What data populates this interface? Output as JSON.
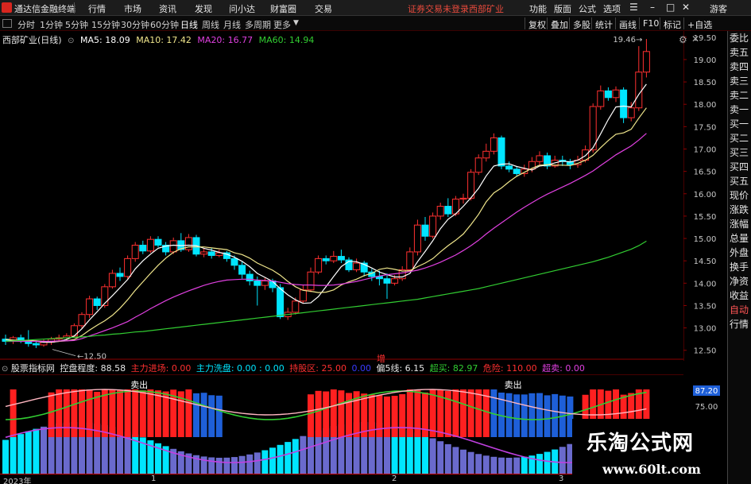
{
  "menu": {
    "app_title": "通达信金融终端",
    "items": [
      "行情",
      "市场",
      "资讯",
      "发现",
      "问小达",
      "财富圈",
      "交易"
    ],
    "notice": "证券交易未登录",
    "stock_name": "西部矿业",
    "right_items": [
      "功能",
      "版面",
      "公式",
      "选项"
    ],
    "guest": "游客"
  },
  "periods": {
    "items": [
      "分时",
      "1分钟",
      "5分钟",
      "15分钟",
      "30分钟",
      "60分钟",
      "日线",
      "周线",
      "月线",
      "多周期",
      "更多"
    ],
    "active": "日线"
  },
  "tools": [
    "复权",
    "叠加",
    "多股",
    "统计",
    "画线",
    "F10",
    "标记",
    "+自选"
  ],
  "legend": {
    "title": "西部矿业(日线)",
    "ma5": "MA5: 18.09",
    "ma10": "MA10: 17.42",
    "ma20": "MA20: 16.77",
    "ma60": "MA60: 14.94"
  },
  "sidebar": [
    "委比",
    "卖五",
    "卖四",
    "卖三",
    "卖二",
    "卖一",
    "买一",
    "买二",
    "买三",
    "买四",
    "买五",
    "现价",
    "涨跌",
    "涨幅",
    "总量",
    "外盘",
    "换手",
    "净资",
    "收益",
    "自动",
    "行情"
  ],
  "indicator": {
    "name": "股票指标网",
    "kpcd_label": "控盘程度:",
    "kpcd": "88.58",
    "zljc_label": "主力进场:",
    "zljc": "0.00",
    "zlxp_label": "主力洗盘:",
    "zlxp": "0.00 : 0.00",
    "ccq_label": "持股区:",
    "ccq": "25.00",
    "jxx_label": "偏5线:",
    "jxx": "6.15",
    "cm_label": "超买:",
    "cm": "82.97",
    "wx_label": "危险:",
    "wx": "110.00",
    "cmai_label": "超卖:",
    "cmai": "0.00",
    "sell_label": "卖出",
    "axis_labels": [
      "87.20",
      "75.00"
    ]
  },
  "increase_mark": "增",
  "dates": [
    "2023年",
    "1",
    "2",
    "3"
  ],
  "watermark": {
    "title": "乐淘公式网",
    "url": "www.60lt.com"
  },
  "colors": {
    "up": "#ff3030",
    "down": "#00e5ff",
    "ma5": "#ffffff",
    "ma10": "#f0e68c",
    "ma20": "#e040e0",
    "ma60": "#32cd32"
  },
  "chart_data": {
    "type": "candlestick",
    "ylim": [
      12.3,
      19.55
    ],
    "y_ticks": [
      "19.50",
      "19.00",
      "18.50",
      "18.00",
      "17.50",
      "17.00",
      "16.50",
      "16.00",
      "15.50",
      "15.00",
      "14.50",
      "14.00",
      "13.50",
      "13.00",
      "12.50"
    ],
    "low_label": "12.50",
    "high_label": "19.46",
    "candles": [
      [
        12.75,
        12.7,
        12.85,
        12.62
      ],
      [
        12.7,
        12.78,
        12.82,
        12.64
      ],
      [
        12.78,
        12.72,
        12.85,
        12.66
      ],
      [
        12.72,
        12.65,
        12.95,
        12.58
      ],
      [
        12.65,
        12.62,
        12.72,
        12.55
      ],
      [
        12.62,
        12.68,
        12.74,
        12.58
      ],
      [
        12.68,
        12.75,
        12.8,
        12.62
      ],
      [
        12.75,
        12.78,
        12.85,
        12.7
      ],
      [
        12.78,
        12.82,
        12.88,
        12.72
      ],
      [
        12.82,
        13.05,
        13.1,
        12.78
      ],
      [
        13.05,
        13.3,
        13.35,
        12.98
      ],
      [
        13.3,
        13.65,
        13.72,
        13.22
      ],
      [
        13.65,
        13.5,
        13.7,
        13.4
      ],
      [
        13.5,
        13.92,
        13.98,
        13.45
      ],
      [
        13.92,
        14.22,
        14.3,
        13.88
      ],
      [
        14.22,
        14.15,
        14.35,
        14.05
      ],
      [
        14.15,
        14.55,
        14.62,
        14.1
      ],
      [
        14.55,
        14.85,
        14.92,
        14.48
      ],
      [
        14.85,
        14.72,
        14.95,
        14.65
      ],
      [
        14.72,
        14.98,
        15.05,
        14.68
      ],
      [
        14.98,
        14.85,
        15.05,
        14.8
      ],
      [
        14.85,
        14.7,
        14.92,
        14.62
      ],
      [
        14.7,
        14.95,
        15.02,
        14.65
      ],
      [
        14.95,
        14.75,
        15.12,
        14.7
      ],
      [
        14.75,
        15.02,
        15.1,
        14.7
      ],
      [
        15.02,
        14.65,
        15.08,
        14.6
      ],
      [
        14.65,
        14.7,
        14.78,
        14.58
      ],
      [
        14.7,
        14.62,
        14.78,
        14.55
      ],
      [
        14.62,
        14.68,
        14.75,
        14.58
      ],
      [
        14.68,
        14.55,
        14.72,
        14.48
      ],
      [
        14.55,
        14.4,
        14.62,
        14.3
      ],
      [
        14.4,
        14.2,
        14.48,
        14.1
      ],
      [
        14.2,
        14.05,
        14.28,
        13.95
      ],
      [
        14.05,
        13.95,
        14.15,
        13.5
      ],
      [
        13.95,
        14.05,
        14.12,
        13.85
      ],
      [
        14.05,
        13.9,
        14.1,
        13.8
      ],
      [
        13.9,
        13.25,
        13.98,
        13.2
      ],
      [
        13.25,
        13.35,
        13.45,
        13.18
      ],
      [
        13.35,
        13.6,
        13.68,
        13.3
      ],
      [
        13.6,
        13.85,
        13.95,
        13.55
      ],
      [
        13.85,
        14.25,
        14.35,
        13.8
      ],
      [
        14.25,
        14.55,
        14.62,
        14.2
      ],
      [
        14.55,
        14.5,
        14.62,
        14.42
      ],
      [
        14.5,
        14.6,
        14.72,
        14.45
      ],
      [
        14.6,
        14.52,
        14.75,
        14.45
      ],
      [
        14.52,
        14.3,
        14.58,
        14.25
      ],
      [
        14.3,
        14.45,
        14.55,
        14.25
      ],
      [
        14.45,
        14.25,
        14.5,
        14.15
      ],
      [
        14.25,
        14.15,
        14.32,
        14.05
      ],
      [
        14.15,
        14.1,
        14.28,
        13.95
      ],
      [
        14.1,
        14.0,
        14.22,
        13.65
      ],
      [
        14.0,
        14.1,
        14.18,
        13.95
      ],
      [
        14.1,
        14.3,
        14.38,
        14.05
      ],
      [
        14.3,
        14.7,
        14.8,
        14.25
      ],
      [
        14.7,
        15.3,
        15.42,
        14.62
      ],
      [
        15.3,
        15.05,
        15.48,
        14.95
      ],
      [
        15.05,
        15.5,
        15.58,
        15.0
      ],
      [
        15.5,
        15.72,
        15.8,
        15.42
      ],
      [
        15.72,
        15.55,
        15.9,
        15.48
      ],
      [
        15.55,
        15.88,
        15.95,
        15.5
      ],
      [
        15.88,
        15.9,
        16.0,
        15.78
      ],
      [
        15.9,
        16.48,
        16.55,
        15.85
      ],
      [
        16.48,
        16.8,
        16.88,
        16.42
      ],
      [
        16.8,
        16.95,
        17.12,
        16.72
      ],
      [
        16.95,
        17.25,
        17.35,
        16.88
      ],
      [
        17.25,
        16.62,
        17.3,
        16.55
      ],
      [
        16.62,
        16.55,
        16.72,
        16.48
      ],
      [
        16.55,
        16.45,
        16.62,
        16.38
      ],
      [
        16.45,
        16.55,
        16.65,
        16.38
      ],
      [
        16.55,
        16.72,
        16.82,
        16.48
      ],
      [
        16.72,
        16.85,
        16.95,
        16.65
      ],
      [
        16.85,
        16.62,
        16.92,
        16.55
      ],
      [
        16.62,
        16.75,
        16.85,
        16.58
      ],
      [
        16.75,
        16.72,
        16.85,
        16.62
      ],
      [
        16.72,
        16.65,
        16.78,
        16.55
      ],
      [
        16.65,
        16.75,
        16.85,
        16.58
      ],
      [
        16.75,
        16.98,
        17.08,
        16.7
      ],
      [
        16.98,
        17.95,
        18.02,
        16.92
      ],
      [
        17.95,
        18.3,
        18.42,
        17.88
      ],
      [
        18.3,
        18.15,
        18.38,
        18.08
      ],
      [
        18.15,
        18.32,
        18.4,
        18.05
      ],
      [
        18.32,
        17.7,
        18.38,
        17.58
      ],
      [
        17.7,
        17.92,
        18.05,
        17.62
      ],
      [
        17.92,
        18.72,
        19.3,
        17.85
      ],
      [
        18.72,
        19.18,
        19.46,
        18.6
      ]
    ],
    "ma_series": [
      {
        "name": "MA5",
        "values": [
          12.74,
          12.72,
          12.72,
          12.71,
          12.7,
          12.68,
          12.68,
          12.7,
          12.74,
          12.82,
          12.98,
          13.18,
          13.36,
          13.55,
          13.72,
          13.9,
          14.08,
          14.32,
          14.5,
          14.65,
          14.78,
          14.83,
          14.85,
          14.84,
          14.85,
          14.84,
          14.78,
          14.74,
          14.69,
          14.65,
          14.58,
          14.49,
          14.37,
          14.22,
          14.13,
          14.04,
          13.88,
          13.74,
          13.63,
          13.55,
          13.56,
          13.7,
          13.92,
          14.15,
          14.37,
          14.49,
          14.48,
          14.42,
          14.34,
          14.25,
          14.19,
          14.14,
          14.14,
          14.22,
          14.48,
          14.71,
          14.95,
          15.22,
          15.43,
          15.55,
          15.72,
          15.91,
          16.12,
          16.4,
          16.62,
          16.66,
          16.67,
          16.61,
          16.57,
          16.53,
          16.62,
          16.64,
          16.69,
          16.73,
          16.71,
          16.75,
          16.85,
          17.03,
          17.34,
          17.66,
          17.94,
          17.96,
          17.94,
          18.22,
          18.45
        ]
      },
      {
        "name": "MA10",
        "values": [
          12.74,
          12.73,
          12.72,
          12.72,
          12.71,
          12.7,
          12.7,
          12.7,
          12.71,
          12.74,
          12.83,
          12.95,
          13.06,
          13.16,
          13.28,
          13.44,
          13.63,
          13.84,
          14.03,
          14.22,
          14.4,
          14.56,
          14.69,
          14.77,
          14.81,
          14.81,
          14.81,
          14.79,
          14.77,
          14.75,
          14.68,
          14.64,
          14.56,
          14.45,
          14.37,
          14.29,
          14.18,
          14.04,
          13.92,
          13.84,
          13.82,
          13.79,
          13.8,
          13.85,
          13.96,
          14.03,
          14.09,
          14.17,
          14.22,
          14.31,
          14.34,
          14.31,
          14.27,
          14.28,
          14.37,
          14.45,
          14.55,
          14.7,
          14.84,
          14.96,
          15.1,
          15.31,
          15.54,
          15.82,
          16.02,
          16.13,
          16.27,
          16.39,
          16.48,
          16.57,
          16.64,
          16.65,
          16.64,
          16.64,
          16.63,
          16.68,
          16.75,
          16.86,
          17.03,
          17.19,
          17.33,
          17.36,
          17.44,
          17.69,
          17.92
        ]
      },
      {
        "name": "MA20",
        "values": [
          12.7,
          12.7,
          12.7,
          12.7,
          12.7,
          12.7,
          12.7,
          12.71,
          12.71,
          12.72,
          12.76,
          12.82,
          12.88,
          12.94,
          13.0,
          13.07,
          13.14,
          13.24,
          13.33,
          13.43,
          13.52,
          13.61,
          13.69,
          13.76,
          13.83,
          13.89,
          13.95,
          14.0,
          14.04,
          14.07,
          14.08,
          14.09,
          14.09,
          14.07,
          14.06,
          14.05,
          14.02,
          13.99,
          13.97,
          13.96,
          13.96,
          13.95,
          13.95,
          13.96,
          13.98,
          14.01,
          14.04,
          14.08,
          14.12,
          14.16,
          14.19,
          14.21,
          14.23,
          14.26,
          14.29,
          14.34,
          14.4,
          14.47,
          14.55,
          14.63,
          14.73,
          14.84,
          14.96,
          15.1,
          15.23,
          15.35,
          15.47,
          15.59,
          15.7,
          15.8,
          15.9,
          15.99,
          16.07,
          16.15,
          16.23,
          16.32,
          16.41,
          16.51,
          16.63,
          16.75,
          16.87,
          16.97,
          17.07,
          17.2,
          17.35
        ]
      },
      {
        "name": "MA60",
        "values": [
          12.7,
          12.71,
          12.72,
          12.73,
          12.74,
          12.75,
          12.76,
          12.77,
          12.78,
          12.79,
          12.8,
          12.81,
          12.83,
          12.84,
          12.86,
          12.87,
          12.89,
          12.91,
          12.92,
          12.94,
          12.96,
          12.98,
          13.0,
          13.02,
          13.04,
          13.06,
          13.08,
          13.1,
          13.12,
          13.14,
          13.16,
          13.18,
          13.2,
          13.22,
          13.24,
          13.26,
          13.28,
          13.3,
          13.32,
          13.34,
          13.36,
          13.38,
          13.4,
          13.42,
          13.44,
          13.46,
          13.48,
          13.5,
          13.52,
          13.54,
          13.56,
          13.58,
          13.6,
          13.62,
          13.64,
          13.67,
          13.7,
          13.73,
          13.76,
          13.79,
          13.82,
          13.85,
          13.88,
          13.92,
          13.96,
          14.0,
          14.04,
          14.08,
          14.12,
          14.16,
          14.2,
          14.24,
          14.28,
          14.32,
          14.36,
          14.4,
          14.44,
          14.48,
          14.53,
          14.58,
          14.64,
          14.7,
          14.76,
          14.84,
          14.94
        ]
      }
    ]
  }
}
